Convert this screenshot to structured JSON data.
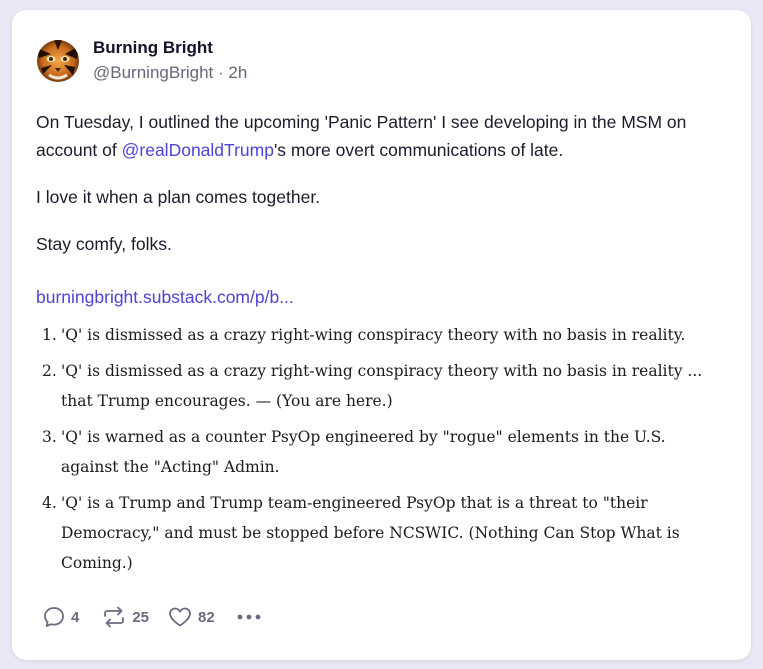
{
  "post": {
    "author": {
      "name": "Burning Bright",
      "handle": "@BurningBright",
      "separator": "·",
      "time": "2h"
    },
    "paragraphs": {
      "p1_before": "On Tuesday, I outlined the upcoming 'Panic Pattern' I see developing in the MSM on account of ",
      "p1_mention": "@realDonaldTrump",
      "p1_after": "'s more overt communications of late.",
      "p2": "I love it when a plan comes together.",
      "p3": "Stay comfy, folks."
    },
    "link_text": "burningbright.substack.com/p/b...",
    "list": [
      {
        "num": "1.",
        "text": "'Q' is dismissed as a crazy right-wing conspiracy theory with no basis in reality."
      },
      {
        "num": "2.",
        "text": "'Q' is dismissed as a crazy right-wing conspiracy theory with no basis in reality ... that Trump encourages. — (You are here.)"
      },
      {
        "num": "3.",
        "text": "'Q' is warned as a counter PsyOp engineered by \"rogue\" elements in the U.S. against the \"Acting\" Admin."
      },
      {
        "num": "4.",
        "text": "'Q' is a Trump and Trump team-engineered PsyOp that is a threat to \"their Democracy,\" and must be stopped before NCSWIC. (Nothing Can Stop What is Coming.)"
      }
    ],
    "actions": {
      "replies": "4",
      "reposts": "25",
      "likes": "82"
    }
  },
  "icons": {
    "reply": "speech-bubble-icon",
    "repost": "repost-arrows-icon",
    "like": "heart-icon",
    "more": "more-dots-icon"
  },
  "colors": {
    "background": "#e9e8f4",
    "card": "#ffffff",
    "text": "#1c1b2e",
    "muted": "#68667a",
    "link": "#4e43d6"
  }
}
